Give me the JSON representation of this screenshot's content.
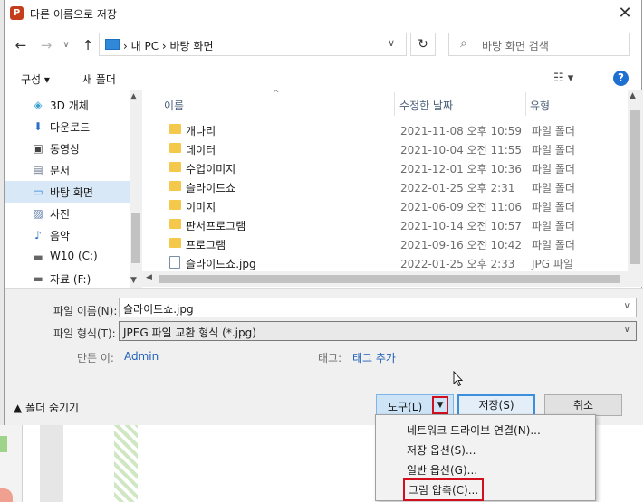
{
  "window": {
    "title": "다른 이름으로 저장",
    "app_icon": "P"
  },
  "address": {
    "path": "›  내 PC  ›  바탕 화면"
  },
  "search": {
    "placeholder": "바탕 화면 검색"
  },
  "toolbar": {
    "organize": "구성 ▾",
    "new_folder": "새 폴더"
  },
  "nav_items": [
    {
      "label": "3D 개체",
      "icon": "cube-icon"
    },
    {
      "label": "다운로드",
      "icon": "download-icon"
    },
    {
      "label": "동영상",
      "icon": "video-icon"
    },
    {
      "label": "문서",
      "icon": "document-icon"
    },
    {
      "label": "바탕 화면",
      "icon": "desktop-icon",
      "selected": true
    },
    {
      "label": "사진",
      "icon": "pictures-icon"
    },
    {
      "label": "음악",
      "icon": "music-icon"
    },
    {
      "label": "W10 (C:)",
      "icon": "drive-icon"
    },
    {
      "label": "자료 (F:)",
      "icon": "drive-icon"
    }
  ],
  "columns": {
    "name": "이름",
    "date": "수정한 날짜",
    "type": "유형"
  },
  "files": [
    {
      "name": "개나리",
      "date": "2021-11-08 오후 10:59",
      "type": "파일 폴더"
    },
    {
      "name": "데이터",
      "date": "2021-10-04 오전 11:55",
      "type": "파일 폴더"
    },
    {
      "name": "수업이미지",
      "date": "2021-12-01 오후 10:36",
      "type": "파일 폴더"
    },
    {
      "name": "슬라이드쇼",
      "date": "2022-01-25 오후 2:31",
      "type": "파일 폴더"
    },
    {
      "name": "이미지",
      "date": "2021-06-09 오전 11:06",
      "type": "파일 폴더"
    },
    {
      "name": "판서프로그램",
      "date": "2021-10-14 오전 10:57",
      "type": "파일 폴더"
    },
    {
      "name": "프로그램",
      "date": "2021-09-16 오전 10:42",
      "type": "파일 폴더"
    },
    {
      "name": "슬라이드쇼.jpg",
      "date": "2022-01-25 오후 2:33",
      "type": "JPG 파일"
    }
  ],
  "form": {
    "filename_label": "파일 이름(N):",
    "filename_value": "슬라이드쇼.jpg",
    "filetype_label": "파일 형식(T):",
    "filetype_value": "JPEG 파일 교환 형식 (*.jpg)",
    "author_label": "만든 이:",
    "author_value": "Admin",
    "tags_label": "태그:",
    "tags_value": "태그 추가",
    "hide_folders": "▲  폴더 숨기기",
    "tools": "도구(L)",
    "save": "저장(S)",
    "cancel": "취소"
  },
  "tools_menu": [
    {
      "label": "네트워크 드라이브 연결(N)..."
    },
    {
      "label": "저장 옵션(S)..."
    },
    {
      "label": "일반 옵션(G)..."
    },
    {
      "label": "그림 압축(C)...",
      "highlighted": true
    }
  ],
  "colors": {
    "accent": "#1f6fd0",
    "highlight_box": "#d0101e",
    "selected_nav": "#d9e8f6",
    "folder": "#f3c84b"
  }
}
